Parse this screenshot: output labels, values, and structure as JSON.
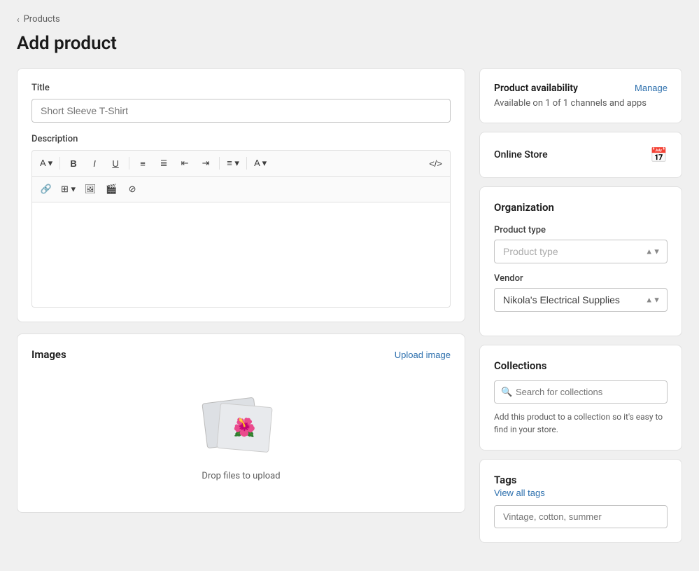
{
  "breadcrumb": {
    "label": "Products",
    "chevron": "‹"
  },
  "page": {
    "title": "Add product"
  },
  "title_field": {
    "label": "Title",
    "placeholder": "Short Sleeve T-Shirt"
  },
  "description_field": {
    "label": "Description"
  },
  "toolbar": {
    "row1": [
      {
        "id": "font",
        "label": "A ▾"
      },
      {
        "id": "bold",
        "label": "B"
      },
      {
        "id": "italic",
        "label": "I"
      },
      {
        "id": "underline",
        "label": "U"
      },
      {
        "id": "bullet-list",
        "label": "☰"
      },
      {
        "id": "ordered-list",
        "label": "☰"
      },
      {
        "id": "outdent",
        "label": "⇤"
      },
      {
        "id": "indent",
        "label": "⇥"
      },
      {
        "id": "align",
        "label": "≡ ▾"
      },
      {
        "id": "color",
        "label": "A ▾"
      },
      {
        "id": "source",
        "label": "</>"
      }
    ],
    "row2": [
      {
        "id": "link",
        "label": "🔗"
      },
      {
        "id": "table",
        "label": "⊞ ▾"
      },
      {
        "id": "image",
        "label": "🖼"
      },
      {
        "id": "video",
        "label": "🎬"
      },
      {
        "id": "clear",
        "label": "⊘"
      }
    ]
  },
  "images": {
    "title": "Images",
    "upload_label": "Upload image",
    "drop_text": "Drop files to upload"
  },
  "availability": {
    "title": "Product availability",
    "manage_label": "Manage",
    "subtitle": "Available on 1 of 1 channels and apps"
  },
  "online_store": {
    "title": "Online Store"
  },
  "organization": {
    "title": "Organization",
    "product_type": {
      "label": "Product type",
      "placeholder": "Product type",
      "options": [
        "Product type"
      ]
    },
    "vendor": {
      "label": "Vendor",
      "value": "Nikola's Electrical Supplies",
      "options": [
        "Nikola's Electrical Supplies"
      ]
    }
  },
  "collections": {
    "title": "Collections",
    "search_placeholder": "Search for collections",
    "hint": "Add this product to a collection so it's easy to find in your store."
  },
  "tags": {
    "title": "Tags",
    "view_all_label": "View all tags",
    "input_placeholder": "Vintage, cotton, summer"
  }
}
